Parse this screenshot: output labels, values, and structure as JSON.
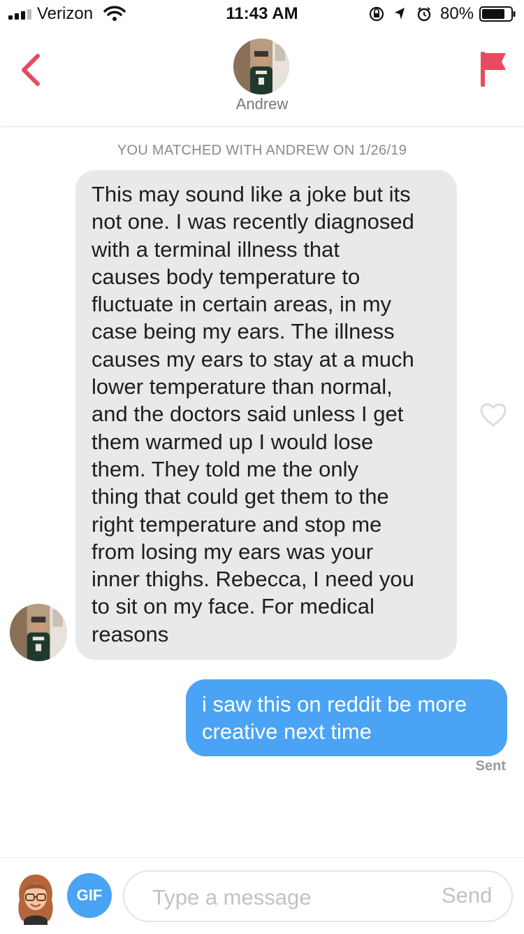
{
  "status_bar": {
    "carrier": "Verizon",
    "time": "11:43 AM",
    "battery_percent": "80%",
    "battery_level": 0.8,
    "icons": [
      "signal-icon",
      "wifi-icon",
      "orientation-lock-icon",
      "location-arrow-icon",
      "alarm-icon",
      "battery-icon"
    ]
  },
  "header": {
    "match_name": "Andrew",
    "icons": [
      "back-chevron-icon",
      "report-flag-icon"
    ]
  },
  "conversation": {
    "match_banner": "YOU MATCHED WITH ANDREW ON 1/26/19",
    "messages": [
      {
        "direction": "received",
        "lines": [
          "This may sound like a joke but its",
          "not one. I was recently diagnosed",
          "with a terminal illness that",
          "causes body temperature to",
          "fluctuate in certain areas, in my",
          "case being my ears. The illness",
          "causes my ears to stay at a much",
          "lower temperature than normal,",
          "and the doctors said unless I get",
          "them warmed up I would lose",
          "them. They told me the only",
          "thing that could get them to the",
          "right temperature and stop me",
          "from losing my ears was your",
          "inner thighs. Rebecca, I need you",
          "to sit on my face. For medical",
          "reasons"
        ]
      },
      {
        "direction": "sent",
        "lines": [
          "i saw this on reddit be more",
          "creative next time"
        ],
        "status": "Sent"
      }
    ]
  },
  "composer": {
    "gif_label": "GIF",
    "placeholder": "Type a message",
    "value": "",
    "send_label": "Send"
  },
  "colors": {
    "accent_red": "#e84a5f",
    "sent_bubble_blue": "#4aa3f5",
    "received_bubble_gray": "#e9e9eb"
  }
}
